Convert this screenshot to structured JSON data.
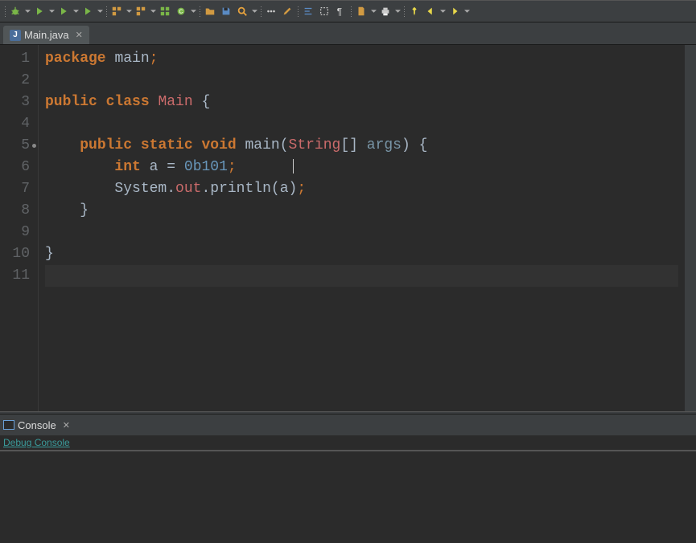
{
  "toolbar": {
    "groups": [
      [
        {
          "name": "bug-icon",
          "svg": "bug",
          "color": "#7ab648",
          "dd": true
        },
        {
          "name": "run-icon",
          "svg": "play",
          "color": "#7ab648",
          "dd": true
        },
        {
          "name": "run-alt-icon",
          "svg": "play",
          "color": "#7ab648",
          "dd": true
        },
        {
          "name": "coverage-icon",
          "svg": "play",
          "color": "#7ab648",
          "dd": true
        }
      ],
      [
        {
          "name": "new-project-icon",
          "svg": "boxes",
          "color": "#d19a42",
          "dd": true
        },
        {
          "name": "new-file-icon",
          "svg": "boxes",
          "color": "#d19a42",
          "dd": true
        },
        {
          "name": "new-package-icon",
          "svg": "grid",
          "color": "#7ab648",
          "dd": false
        },
        {
          "name": "new-class-icon",
          "svg": "circle",
          "color": "#7ab648",
          "dd": true
        }
      ],
      [
        {
          "name": "open-folder-icon",
          "svg": "folder",
          "color": "#d19a42",
          "dd": false
        },
        {
          "name": "save-icon",
          "svg": "disk",
          "color": "#5a8bc4",
          "dd": false
        },
        {
          "name": "search-icon",
          "svg": "magnify",
          "color": "#e8a33d",
          "dd": true
        }
      ],
      [
        {
          "name": "toggle-breakpoint-icon",
          "svg": "dots",
          "color": "#ccc",
          "dd": false
        },
        {
          "name": "edit-icon",
          "svg": "pencil",
          "color": "#d19a42",
          "dd": false
        }
      ],
      [
        {
          "name": "format-icon",
          "svg": "lines",
          "color": "#5a8bc4",
          "dd": false
        },
        {
          "name": "block-icon",
          "svg": "block",
          "color": "#ccc",
          "dd": false
        },
        {
          "name": "pilcrow-icon",
          "svg": "pilcrow",
          "color": "#ccc",
          "dd": false
        }
      ],
      [
        {
          "name": "page-icon",
          "svg": "page",
          "color": "#d19a42",
          "dd": true
        },
        {
          "name": "print-icon",
          "svg": "print",
          "color": "#ccc",
          "dd": true
        }
      ],
      [
        {
          "name": "pin-icon",
          "svg": "pin",
          "color": "#e8d84a",
          "dd": false
        },
        {
          "name": "back-icon",
          "svg": "larrow",
          "color": "#e8d84a",
          "dd": true
        },
        {
          "name": "forward-icon",
          "svg": "rarrow",
          "color": "#e8d84a",
          "dd": true
        }
      ]
    ]
  },
  "editor": {
    "tab_label": "Main.java",
    "lines": [
      {
        "n": "1",
        "tokens": [
          [
            "kw2",
            "package"
          ],
          [
            "sp",
            " "
          ],
          [
            "id",
            "main"
          ],
          [
            "punct",
            ";"
          ]
        ]
      },
      {
        "n": "2",
        "tokens": []
      },
      {
        "n": "3",
        "tokens": [
          [
            "kw2",
            "public"
          ],
          [
            "sp",
            " "
          ],
          [
            "kw2",
            "class"
          ],
          [
            "sp",
            " "
          ],
          [
            "clsname",
            "Main"
          ],
          [
            "sp",
            " "
          ],
          [
            "id",
            "{"
          ]
        ]
      },
      {
        "n": "4",
        "tokens": []
      },
      {
        "n": "5",
        "marker": true,
        "tokens": [
          [
            "sp",
            "    "
          ],
          [
            "kw2",
            "public"
          ],
          [
            "sp",
            " "
          ],
          [
            "kw2",
            "static"
          ],
          [
            "sp",
            " "
          ],
          [
            "kw2",
            "void"
          ],
          [
            "sp",
            " "
          ],
          [
            "id",
            "main"
          ],
          [
            "id",
            "("
          ],
          [
            "type",
            "String"
          ],
          [
            "id",
            "[]"
          ],
          [
            "sp",
            " "
          ],
          [
            "param",
            "args"
          ],
          [
            "id",
            ")"
          ],
          [
            "sp",
            " "
          ],
          [
            "id",
            "{"
          ]
        ]
      },
      {
        "n": "6",
        "caret": true,
        "tokens": [
          [
            "sp",
            "        "
          ],
          [
            "kw2",
            "int"
          ],
          [
            "sp",
            " "
          ],
          [
            "id",
            "a"
          ],
          [
            "sp",
            " "
          ],
          [
            "id",
            "="
          ],
          [
            "sp",
            " "
          ],
          [
            "num",
            "0b101"
          ],
          [
            "punct",
            ";"
          ]
        ]
      },
      {
        "n": "7",
        "tokens": [
          [
            "sp",
            "        "
          ],
          [
            "id",
            "System"
          ],
          [
            "id",
            "."
          ],
          [
            "type",
            "out"
          ],
          [
            "id",
            "."
          ],
          [
            "id",
            "println"
          ],
          [
            "id",
            "("
          ],
          [
            "id",
            "a"
          ],
          [
            "id",
            ")"
          ],
          [
            "punct",
            ";"
          ]
        ]
      },
      {
        "n": "8",
        "tokens": [
          [
            "sp",
            "    "
          ],
          [
            "id",
            "}"
          ]
        ]
      },
      {
        "n": "9",
        "tokens": []
      },
      {
        "n": "10",
        "tokens": [
          [
            "id",
            "}"
          ]
        ]
      },
      {
        "n": "11",
        "current": true,
        "tokens": []
      }
    ]
  },
  "console": {
    "tab_label": "Console",
    "sub_label": "Debug Console"
  }
}
